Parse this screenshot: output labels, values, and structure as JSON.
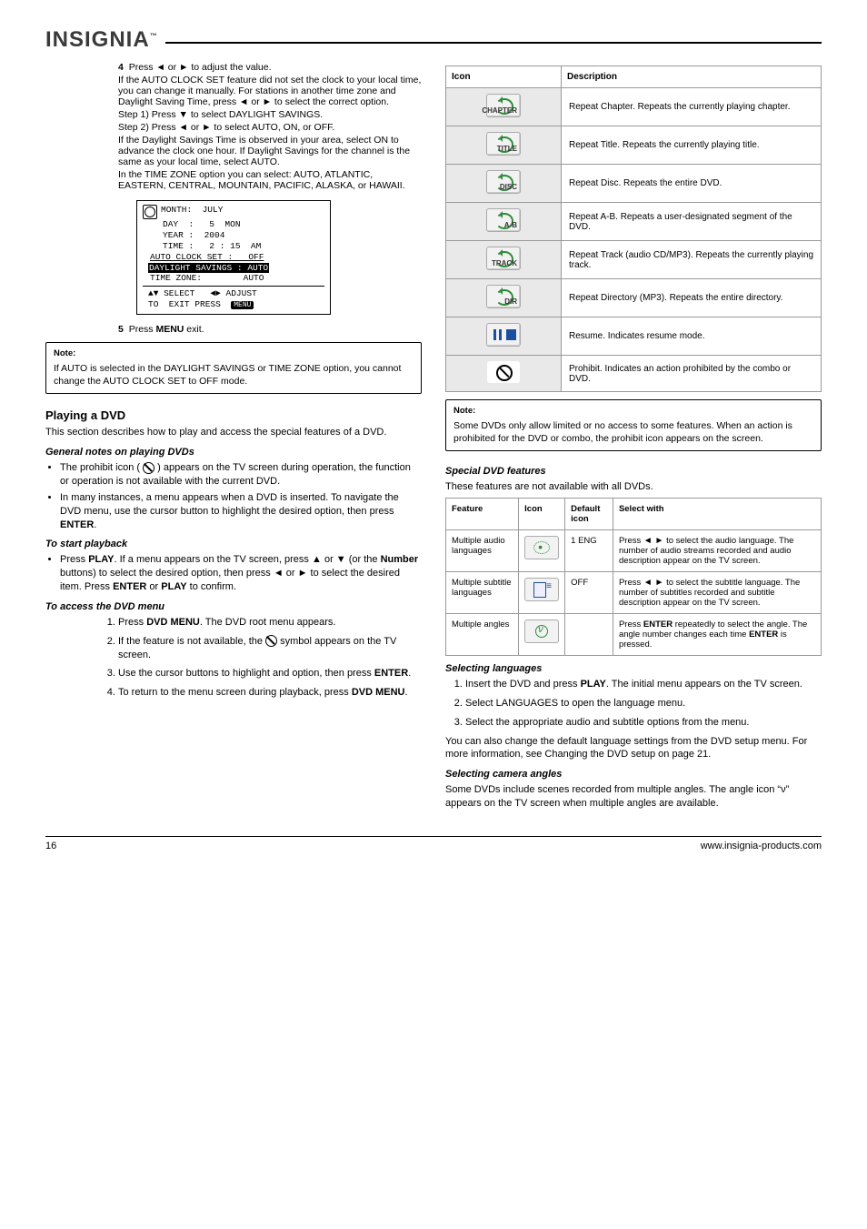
{
  "brand": "INSIGNIA",
  "brand_tm": "™",
  "left": {
    "steps": [
      {
        "num": "4",
        "html": "Press ◄ or ► to adjust the value.",
        "sub": [
          "If the AUTO CLOCK SET feature did not set the clock to your local time, you can change it manually. For stations in another time zone and Daylight Saving Time, press ◄ or ► to select the correct option.",
          "Step 1) Press ▼ to select DAYLIGHT SAVINGS.",
          "Step 2) Press ◄ or ► to select AUTO, ON, or OFF.",
          "If the Daylight Savings Time is observed in your area, select ON to advance the clock one hour. If Daylight Savings for the channel is the same as your local time, select AUTO.",
          "In the TIME ZONE option you can select: AUTO, ATLANTIC, EASTERN, CENTRAL, MOUNTAIN, PACIFIC, ALASKA, or HAWAII."
        ]
      },
      {
        "num": "5",
        "html": "Press <b>MENU</b> exit."
      }
    ],
    "diagram": {
      "rows": [
        "MONTH:  JULY",
        "DAY  :   5  MON",
        "YEAR :  2004",
        "TIME :   2 : 15  AM",
        "AUTO CLOCK SET :   OFF"
      ],
      "highlight": "DAYLIGHT SAVINGS : AUTO",
      "row6": "TIME ZONE:        AUTO",
      "footer1a": "▲▼ SELECT",
      "footer1b": "◄► ADJUST",
      "footer2": "TO  EXIT PRESS  MENU"
    },
    "note1": {
      "label": "Note:",
      "text": "If AUTO is selected in the DAYLIGHT SAVINGS or TIME ZONE option, you cannot change the AUTO CLOCK SET to OFF mode."
    },
    "h_playing": "Playing a DVD",
    "p_intro": "This section describes how to play and access the special features of a DVD.",
    "h_notes": "General notes on playing DVDs",
    "notes_bullets": [
      {
        "text": "The prohibit icon ( ⃠ ) appears on the TV screen during operation, the function or operation is not available with the current DVD."
      },
      {
        "text": "In many instances, a menu appears when a DVD is inserted. To navigate the DVD menu, use the cursor button to highlight the desired option, then press <b>ENTER</b>."
      }
    ],
    "h_start": "To start playback",
    "start_bullets": [
      {
        "text": "Press <b>PLAY</b>. If a menu appears on the TV screen, press ▲ or ▼ (or the <b>Number</b> buttons) to select the desired option, then press ◄ or ► to select the desired item. Press <b>ENTER</b> or <b>PLAY</b> to confirm."
      }
    ],
    "h_dvdmenu": "To access the DVD menu",
    "dvdmenu_steps": [
      {
        "num": "1",
        "text": "Press <b>DVD MENU</b>. The DVD root menu appears."
      },
      {
        "num": "2",
        "text": "If the feature is not available, the ⃠ symbol appears on the TV screen."
      },
      {
        "num": "3",
        "text": "Use the cursor buttons to highlight and option, then press <b>ENTER</b>."
      },
      {
        "num": "4",
        "text": "To return to the menu screen during playback, press <b>DVD MENU</b>."
      }
    ]
  },
  "right": {
    "table1": {
      "headers": [
        "Icon",
        "Description"
      ],
      "rows": [
        {
          "icon": "repeat-chapter",
          "sub": "CHAPTER",
          "desc": "Repeat Chapter. Repeats the currently playing chapter."
        },
        {
          "icon": "repeat-title",
          "sub": "TITLE",
          "desc": "Repeat Title. Repeats the currently playing title."
        },
        {
          "icon": "repeat-disc",
          "sub": "DISC",
          "desc": "Repeat Disc. Repeats the entire DVD."
        },
        {
          "icon": "repeat-ab",
          "sub": "A-B",
          "desc": "Repeat A-B. Repeats a user-designated segment of the DVD."
        },
        {
          "icon": "repeat-track",
          "sub": "TRACK",
          "desc": "Repeat Track (audio CD/MP3). Repeats the currently playing track."
        },
        {
          "icon": "repeat-dir",
          "sub": "DIR",
          "desc": "Repeat Directory (MP3). Repeats the entire directory."
        },
        {
          "icon": "pause-stop",
          "desc": "Resume. Indicates resume mode."
        },
        {
          "icon": "prohibit",
          "desc": "Prohibit. Indicates an action prohibited by the combo or DVD."
        }
      ]
    },
    "note2": {
      "label": "Note:",
      "text": "Some DVDs only allow limited or no access to some features. When an action is prohibited for the DVD or combo, the prohibit icon appears on the screen."
    },
    "h_features": "Special DVD features",
    "p_features": "These features are not available with all DVDs.",
    "table2": {
      "headers": [
        "Feature",
        "Icon",
        "Default icon",
        "Select with"
      ],
      "rows": [
        {
          "feature": "Multiple audio languages",
          "icon": "audio",
          "default": "1 ENG",
          "select": "Press ◄ ► to select the audio language. The number of audio streams recorded and audio description appear on the TV screen."
        },
        {
          "feature": "Multiple subtitle languages",
          "icon": "subtitle",
          "default": "OFF",
          "select": "Press ◄ ► to select the subtitle language. The number of subtitles recorded and subtitle description appear on the TV screen."
        },
        {
          "feature": "Multiple angles",
          "icon": "angle",
          "default": "",
          "select": "Press <b>ENTER</b> repeatedly to select the angle. The angle number changes each time <b>ENTER</b> is pressed."
        }
      ]
    },
    "h_languages": "Selecting languages",
    "lang_steps": [
      {
        "num": "1",
        "text": "Insert the DVD and press <b>PLAY</b>. The initial menu appears on the TV screen."
      },
      {
        "num": "2",
        "text": "Select LANGUAGES to open the language menu."
      },
      {
        "num": "3",
        "text": "Select the appropriate audio and subtitle options from the menu."
      }
    ],
    "p_lang_note": "You can also change the default language settings from the DVD setup menu. For more information, see Changing the DVD setup on page 21.",
    "h_angles": "Selecting camera angles",
    "p_angles": "Some DVDs include scenes recorded from multiple angles. The angle icon “ν” appears on the TV screen when multiple angles are available."
  },
  "footer": {
    "page": "16",
    "site": "www.insignia-products.com"
  }
}
